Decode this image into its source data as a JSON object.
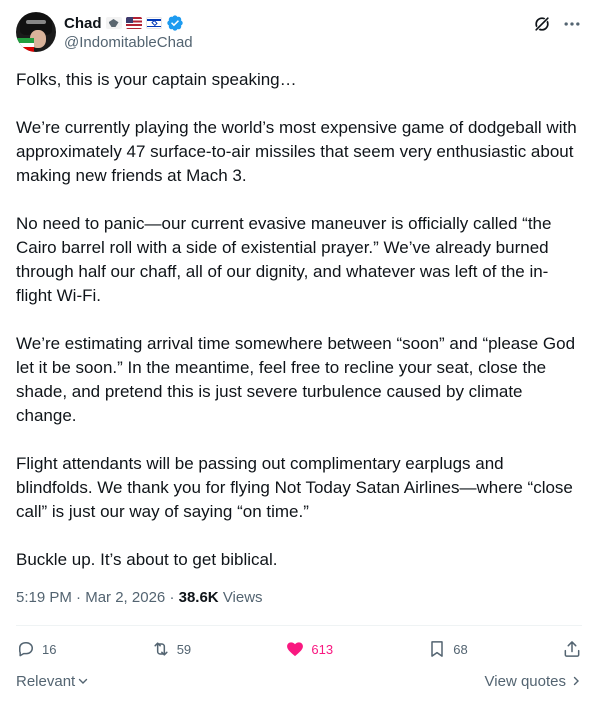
{
  "author": {
    "display_name": "Chad",
    "name_emojis": [
      "pilot-emoji",
      "us-flag-emoji",
      "israel-flag-emoji"
    ],
    "verified": true,
    "handle": "@IndomitableChad"
  },
  "post": {
    "paragraphs": [
      "Folks, this is your captain speaking…",
      "We’re currently playing the world’s most expensive game of dodgeball with approximately 47 surface-to-air missiles that seem very enthusiastic about making new friends at Mach 3.",
      "No need to panic—our current evasive maneuver is officially called “the Cairo barrel roll with a side of existential prayer.” We’ve already burned through half our chaff, all of our dignity, and whatever was left of the in-flight Wi-Fi.",
      "We’re estimating arrival time somewhere between “soon” and “please God let it be soon.” In the meantime, feel free to recline your seat, close the shade, and pretend this is just severe turbulence caused by climate change.",
      "Flight attendants will be passing out complimentary earplugs and blindfolds. We thank you for flying Not Today Satan Airlines—where “close call” is just our way of saying “on time.”",
      "Buckle up. It’s about to get biblical."
    ],
    "time": "5:19 PM",
    "separator": "·",
    "date": "Mar 2, 2026",
    "views_count": "38.6K",
    "views_label": "Views"
  },
  "actions": {
    "replies": "16",
    "reposts": "59",
    "likes": "613",
    "bookmarks": "68"
  },
  "footer": {
    "sort_label": "Relevant",
    "view_quotes_label": "View quotes"
  },
  "colors": {
    "text": "#0f1419",
    "secondary": "#536471",
    "like": "#f91880",
    "verified": "#1d9bf0"
  }
}
